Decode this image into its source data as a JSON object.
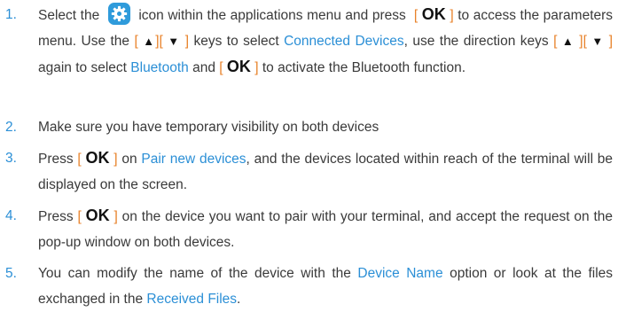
{
  "icons": {
    "settings_icon": "settings-gear-icon",
    "icon_color": "#2f9bdb"
  },
  "colors": {
    "number": "#2b8fd6",
    "link": "#2b8fd6",
    "bracket": "#e8822a",
    "text": "#3a3a3a"
  },
  "steps": [
    {
      "number": "1.",
      "t1": "Select the",
      "t2": "icon within the applications menu and press",
      "ok": "OK",
      "t3": "to access the parameters menu. Use the",
      "t4": "keys to select",
      "link1": "Connected Devices",
      "t5": ", use the direction keys",
      "t6": "again to select",
      "link2": "Bluetooth",
      "t7": "and",
      "t8": "to activate the Bluetooth function."
    },
    {
      "number": "2.",
      "text": "Make sure you have temporary visibility on both devices"
    },
    {
      "number": "3.",
      "t1": "Press",
      "ok": "OK",
      "t2": "on",
      "link1": "Pair new devices",
      "t3": ", and the devices located within reach of the terminal will be displayed on the screen."
    },
    {
      "number": "4.",
      "t1": "Press",
      "ok": "OK",
      "t2": "on the device you want to pair with your terminal, and accept the request on the pop-up window on both devices."
    },
    {
      "number": "5.",
      "t1": "You can modify the name of the device with the",
      "link1": "Device Name",
      "t2": "option or look at the files exchanged in the",
      "link2": "Received Files",
      "t3": "."
    }
  ],
  "symbols": {
    "open": "[",
    "close": "]",
    "up": "▲",
    "down": "▼"
  }
}
